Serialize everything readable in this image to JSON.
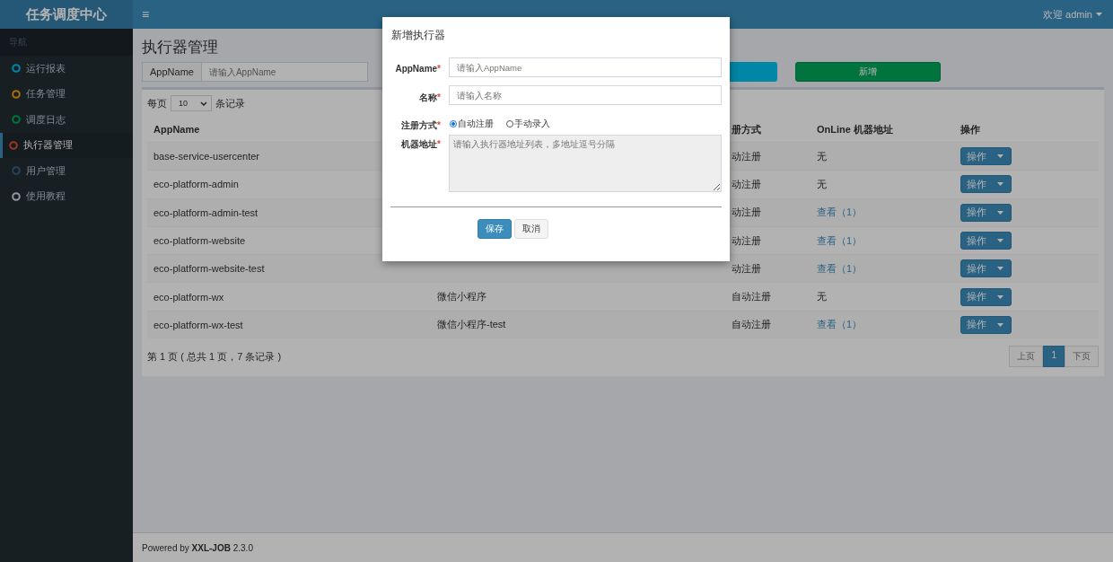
{
  "header": {
    "logo": "任务调度中心",
    "menu_icon": "≡",
    "user": "欢迎 admin"
  },
  "sidebar": {
    "heading": "导航",
    "items": [
      {
        "label": "运行报表",
        "color": "#0086a7",
        "selected": false
      },
      {
        "label": "任务管理",
        "color": "#aa6d0d",
        "selected": false
      },
      {
        "label": "调度日志",
        "color": "#00743f",
        "selected": false
      },
      {
        "label": "执行器管理",
        "color": "#9b3528",
        "selected": true
      },
      {
        "label": "用户管理",
        "color": "#2a3f62",
        "selected": false
      },
      {
        "label": "使用教程",
        "color": "#93969b",
        "selected": false
      }
    ]
  },
  "page_title": "执行器管理",
  "filter": {
    "addon": "AppName",
    "placeholder": "请输入AppName",
    "add_button": "新增"
  },
  "table": {
    "page_size": {
      "prefix": "每页",
      "value": "10",
      "suffix": "条记录"
    },
    "columns": [
      "AppName",
      "",
      "册方式",
      "OnLine 机器地址",
      "操作"
    ],
    "rows": [
      {
        "appname": "base-service-usercenter",
        "register": "动注册",
        "online": "无",
        "online_link": false,
        "action": "操作"
      },
      {
        "appname": "eco-platform-admin",
        "register": "动注册",
        "online": "无",
        "online_link": false,
        "action": "操作"
      },
      {
        "appname": "eco-platform-admin-test",
        "register": "动注册",
        "online": "查看（1）",
        "online_link": true,
        "action": "操作"
      },
      {
        "appname": "eco-platform-website",
        "register": "动注册",
        "online": "查看（1）",
        "online_link": true,
        "action": "操作"
      },
      {
        "appname": "eco-platform-website-test",
        "register": "动注册",
        "online": "查看（1）",
        "online_link": true,
        "action": "操作"
      },
      {
        "appname": "eco-platform-wx",
        "name": "微信小程序",
        "register": "自动注册",
        "online": "无",
        "online_link": false,
        "action": "操作"
      },
      {
        "appname": "eco-platform-wx-test",
        "name": "微信小程序-test",
        "register": "自动注册",
        "online": "查看（1）",
        "online_link": true,
        "action": "操作"
      }
    ],
    "summary": "第 1 页 ( 总共 1 页，7 条记录 )",
    "pages": [
      {
        "label": "上页",
        "selected": false
      },
      {
        "label": "1",
        "selected": true
      },
      {
        "label": "下页",
        "selected": false
      }
    ]
  },
  "footer": {
    "text": "Powered by **XXL-JOB** 2.3.0"
  },
  "modal": {
    "title": "新增执行器",
    "fields": [
      {
        "kind": "input",
        "label": "AppName",
        "required_mark": "*",
        "placeholder": "请输入AppName"
      },
      {
        "kind": "input",
        "label": "名称",
        "required_mark": "*",
        "placeholder": "请输入名称"
      },
      {
        "kind": "radio",
        "label": "注册方式",
        "required_mark": "*",
        "options": [
          {
            "label": "自动注册",
            "selected": true
          },
          {
            "label": "手动录入",
            "selected": false
          }
        ]
      },
      {
        "kind": "textarea",
        "label": "机器地址",
        "required_mark": "*",
        "placeholder": "请输入执行器地址列表，多地址逗号分隔"
      }
    ],
    "buttons": [
      {
        "label": "保存",
        "kind": "primary"
      },
      {
        "label": "取消",
        "kind": "default"
      }
    ]
  }
}
